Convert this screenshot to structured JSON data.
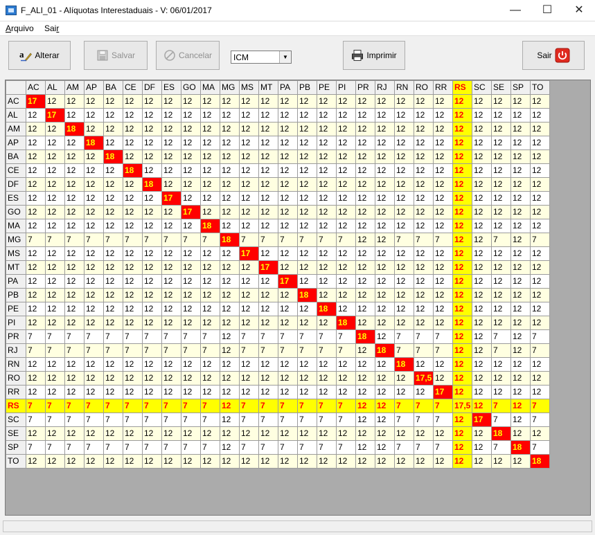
{
  "window": {
    "title": "F_ALI_01 - Alíquotas Interestaduais - V: 06/01/2017",
    "minimize": "—",
    "maximize": "☐",
    "close": "✕"
  },
  "menu": [
    {
      "label": "Arquivo"
    },
    {
      "label": "Sair"
    }
  ],
  "toolbar": {
    "alterar_label": "Alterar",
    "salvar_label": "Salvar",
    "cancelar_label": "Cancelar",
    "tax_select": "ICM",
    "imprimir_label": "Imprimir",
    "sair_label": "Sair"
  },
  "states": [
    "AC",
    "AL",
    "AM",
    "AP",
    "BA",
    "CE",
    "DF",
    "ES",
    "GO",
    "MA",
    "MG",
    "MS",
    "MT",
    "PA",
    "PB",
    "PE",
    "PI",
    "PR",
    "RJ",
    "RN",
    "RO",
    "RR",
    "RS",
    "SC",
    "SE",
    "SP",
    "TO"
  ],
  "highlight_state": "RS",
  "highlight_color": "#ffff00",
  "diagonal_color": "#ff0000",
  "rates": [
    [
      "17",
      "12",
      "12",
      "12",
      "12",
      "12",
      "12",
      "12",
      "12",
      "12",
      "12",
      "12",
      "12",
      "12",
      "12",
      "12",
      "12",
      "12",
      "12",
      "12",
      "12",
      "12",
      "12",
      "12",
      "12",
      "12",
      "12"
    ],
    [
      "12",
      "17",
      "12",
      "12",
      "12",
      "12",
      "12",
      "12",
      "12",
      "12",
      "12",
      "12",
      "12",
      "12",
      "12",
      "12",
      "12",
      "12",
      "12",
      "12",
      "12",
      "12",
      "12",
      "12",
      "12",
      "12",
      "12"
    ],
    [
      "12",
      "12",
      "18",
      "12",
      "12",
      "12",
      "12",
      "12",
      "12",
      "12",
      "12",
      "12",
      "12",
      "12",
      "12",
      "12",
      "12",
      "12",
      "12",
      "12",
      "12",
      "12",
      "12",
      "12",
      "12",
      "12",
      "12"
    ],
    [
      "12",
      "12",
      "12",
      "18",
      "12",
      "12",
      "12",
      "12",
      "12",
      "12",
      "12",
      "12",
      "12",
      "12",
      "12",
      "12",
      "12",
      "12",
      "12",
      "12",
      "12",
      "12",
      "12",
      "12",
      "12",
      "12",
      "12"
    ],
    [
      "12",
      "12",
      "12",
      "12",
      "18",
      "12",
      "12",
      "12",
      "12",
      "12",
      "12",
      "12",
      "12",
      "12",
      "12",
      "12",
      "12",
      "12",
      "12",
      "12",
      "12",
      "12",
      "12",
      "12",
      "12",
      "12",
      "12"
    ],
    [
      "12",
      "12",
      "12",
      "12",
      "12",
      "18",
      "12",
      "12",
      "12",
      "12",
      "12",
      "12",
      "12",
      "12",
      "12",
      "12",
      "12",
      "12",
      "12",
      "12",
      "12",
      "12",
      "12",
      "12",
      "12",
      "12",
      "12"
    ],
    [
      "12",
      "12",
      "12",
      "12",
      "12",
      "12",
      "18",
      "12",
      "12",
      "12",
      "12",
      "12",
      "12",
      "12",
      "12",
      "12",
      "12",
      "12",
      "12",
      "12",
      "12",
      "12",
      "12",
      "12",
      "12",
      "12",
      "12"
    ],
    [
      "12",
      "12",
      "12",
      "12",
      "12",
      "12",
      "12",
      "17",
      "12",
      "12",
      "12",
      "12",
      "12",
      "12",
      "12",
      "12",
      "12",
      "12",
      "12",
      "12",
      "12",
      "12",
      "12",
      "12",
      "12",
      "12",
      "12"
    ],
    [
      "12",
      "12",
      "12",
      "12",
      "12",
      "12",
      "12",
      "12",
      "17",
      "12",
      "12",
      "12",
      "12",
      "12",
      "12",
      "12",
      "12",
      "12",
      "12",
      "12",
      "12",
      "12",
      "12",
      "12",
      "12",
      "12",
      "12"
    ],
    [
      "12",
      "12",
      "12",
      "12",
      "12",
      "12",
      "12",
      "12",
      "12",
      "18",
      "12",
      "12",
      "12",
      "12",
      "12",
      "12",
      "12",
      "12",
      "12",
      "12",
      "12",
      "12",
      "12",
      "12",
      "12",
      "12",
      "12"
    ],
    [
      "7",
      "7",
      "7",
      "7",
      "7",
      "7",
      "7",
      "7",
      "7",
      "7",
      "18",
      "7",
      "7",
      "7",
      "7",
      "7",
      "7",
      "12",
      "12",
      "7",
      "7",
      "7",
      "12",
      "12",
      "7",
      "12",
      "7"
    ],
    [
      "12",
      "12",
      "12",
      "12",
      "12",
      "12",
      "12",
      "12",
      "12",
      "12",
      "12",
      "17",
      "12",
      "12",
      "12",
      "12",
      "12",
      "12",
      "12",
      "12",
      "12",
      "12",
      "12",
      "12",
      "12",
      "12",
      "12"
    ],
    [
      "12",
      "12",
      "12",
      "12",
      "12",
      "12",
      "12",
      "12",
      "12",
      "12",
      "12",
      "12",
      "17",
      "12",
      "12",
      "12",
      "12",
      "12",
      "12",
      "12",
      "12",
      "12",
      "12",
      "12",
      "12",
      "12",
      "12"
    ],
    [
      "12",
      "12",
      "12",
      "12",
      "12",
      "12",
      "12",
      "12",
      "12",
      "12",
      "12",
      "12",
      "12",
      "17",
      "12",
      "12",
      "12",
      "12",
      "12",
      "12",
      "12",
      "12",
      "12",
      "12",
      "12",
      "12",
      "12"
    ],
    [
      "12",
      "12",
      "12",
      "12",
      "12",
      "12",
      "12",
      "12",
      "12",
      "12",
      "12",
      "12",
      "12",
      "12",
      "18",
      "12",
      "12",
      "12",
      "12",
      "12",
      "12",
      "12",
      "12",
      "12",
      "12",
      "12",
      "12"
    ],
    [
      "12",
      "12",
      "12",
      "12",
      "12",
      "12",
      "12",
      "12",
      "12",
      "12",
      "12",
      "12",
      "12",
      "12",
      "12",
      "18",
      "12",
      "12",
      "12",
      "12",
      "12",
      "12",
      "12",
      "12",
      "12",
      "12",
      "12"
    ],
    [
      "12",
      "12",
      "12",
      "12",
      "12",
      "12",
      "12",
      "12",
      "12",
      "12",
      "12",
      "12",
      "12",
      "12",
      "12",
      "12",
      "18",
      "12",
      "12",
      "12",
      "12",
      "12",
      "12",
      "12",
      "12",
      "12",
      "12"
    ],
    [
      "7",
      "7",
      "7",
      "7",
      "7",
      "7",
      "7",
      "7",
      "7",
      "7",
      "12",
      "7",
      "7",
      "7",
      "7",
      "7",
      "7",
      "18",
      "12",
      "7",
      "7",
      "7",
      "12",
      "12",
      "7",
      "12",
      "7"
    ],
    [
      "7",
      "7",
      "7",
      "7",
      "7",
      "7",
      "7",
      "7",
      "7",
      "7",
      "12",
      "7",
      "7",
      "7",
      "7",
      "7",
      "7",
      "12",
      "18",
      "7",
      "7",
      "7",
      "12",
      "12",
      "7",
      "12",
      "7"
    ],
    [
      "12",
      "12",
      "12",
      "12",
      "12",
      "12",
      "12",
      "12",
      "12",
      "12",
      "12",
      "12",
      "12",
      "12",
      "12",
      "12",
      "12",
      "12",
      "12",
      "18",
      "12",
      "12",
      "12",
      "12",
      "12",
      "12",
      "12"
    ],
    [
      "12",
      "12",
      "12",
      "12",
      "12",
      "12",
      "12",
      "12",
      "12",
      "12",
      "12",
      "12",
      "12",
      "12",
      "12",
      "12",
      "12",
      "12",
      "12",
      "12",
      "17,5",
      "12",
      "12",
      "12",
      "12",
      "12",
      "12"
    ],
    [
      "12",
      "12",
      "12",
      "12",
      "12",
      "12",
      "12",
      "12",
      "12",
      "12",
      "12",
      "12",
      "12",
      "12",
      "12",
      "12",
      "12",
      "12",
      "12",
      "12",
      "12",
      "17",
      "12",
      "12",
      "12",
      "12",
      "12"
    ],
    [
      "7",
      "7",
      "7",
      "7",
      "7",
      "7",
      "7",
      "7",
      "7",
      "7",
      "12",
      "7",
      "7",
      "7",
      "7",
      "7",
      "7",
      "12",
      "12",
      "7",
      "7",
      "7",
      "17,5",
      "12",
      "7",
      "12",
      "7"
    ],
    [
      "7",
      "7",
      "7",
      "7",
      "7",
      "7",
      "7",
      "7",
      "7",
      "7",
      "12",
      "7",
      "7",
      "7",
      "7",
      "7",
      "7",
      "12",
      "12",
      "7",
      "7",
      "7",
      "12",
      "17",
      "7",
      "12",
      "7"
    ],
    [
      "12",
      "12",
      "12",
      "12",
      "12",
      "12",
      "12",
      "12",
      "12",
      "12",
      "12",
      "12",
      "12",
      "12",
      "12",
      "12",
      "12",
      "12",
      "12",
      "12",
      "12",
      "12",
      "12",
      "12",
      "18",
      "12",
      "12"
    ],
    [
      "7",
      "7",
      "7",
      "7",
      "7",
      "7",
      "7",
      "7",
      "7",
      "7",
      "12",
      "7",
      "7",
      "7",
      "7",
      "7",
      "7",
      "12",
      "12",
      "7",
      "7",
      "7",
      "12",
      "12",
      "7",
      "18",
      "7"
    ],
    [
      "12",
      "12",
      "12",
      "12",
      "12",
      "12",
      "12",
      "12",
      "12",
      "12",
      "12",
      "12",
      "12",
      "12",
      "12",
      "12",
      "12",
      "12",
      "12",
      "12",
      "12",
      "12",
      "12",
      "12",
      "12",
      "12",
      "18"
    ]
  ]
}
